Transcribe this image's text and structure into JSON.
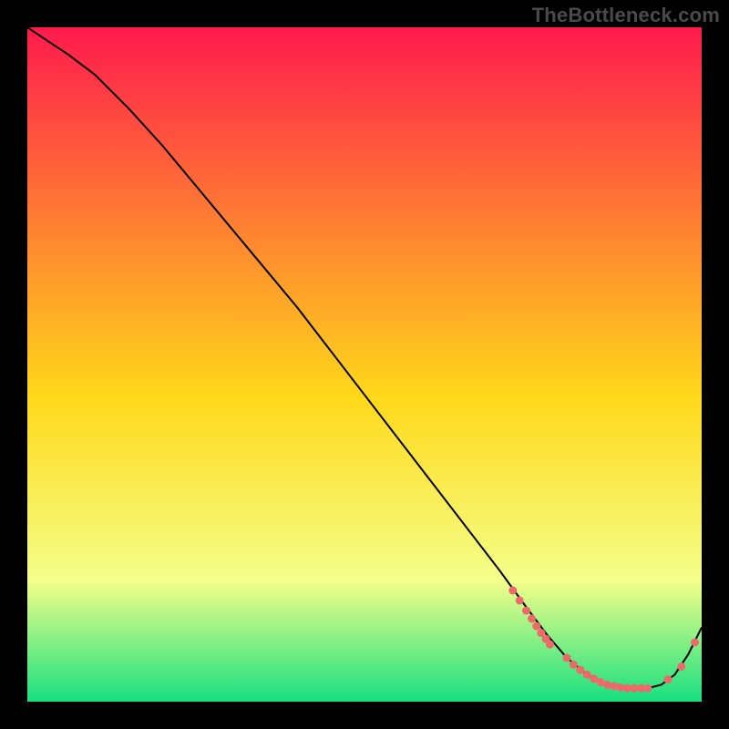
{
  "watermark": "TheBottleneck.com",
  "chart_data": {
    "type": "line",
    "title": "",
    "xlabel": "",
    "ylabel": "",
    "xlim": [
      0,
      100
    ],
    "ylim": [
      0,
      100
    ],
    "grid": false,
    "legend": false,
    "background_gradient": {
      "top": "#ff1a4d",
      "mid": "#ffd91a",
      "lower": "#f4ff8a",
      "bottom": "#17e080"
    },
    "series": [
      {
        "name": "bottleneck-curve",
        "color": "#000000",
        "x": [
          0,
          3,
          6,
          10,
          15,
          20,
          25,
          30,
          35,
          40,
          45,
          50,
          55,
          60,
          65,
          70,
          74,
          77,
          80,
          83,
          86,
          89,
          92,
          94,
          96,
          98,
          100
        ],
        "y": [
          100,
          98,
          96,
          93,
          88,
          82.5,
          76.5,
          70.5,
          64.5,
          58.5,
          52,
          45.5,
          39,
          32.5,
          26,
          19.5,
          14,
          10,
          6.5,
          4,
          2.5,
          2,
          2,
          2.5,
          4,
          7,
          11
        ]
      }
    ],
    "markers": {
      "name": "highlight-dots",
      "color": "#ed6a6a",
      "radius": 4.5,
      "clusters": [
        {
          "comment": "descending-edge cluster",
          "x": [
            72.0,
            73.0,
            74.0,
            74.8,
            75.5,
            76.2,
            76.9,
            77.5
          ],
          "y": [
            16.5,
            15.0,
            13.5,
            12.3,
            11.2,
            10.2,
            9.3,
            8.5
          ]
        },
        {
          "comment": "valley floor cluster",
          "x": [
            80.0,
            81.0,
            82.0,
            83.0,
            84.0,
            85.0,
            86.0,
            87.0,
            88.0,
            89.0,
            90.0,
            91.0,
            92.0
          ],
          "y": [
            6.5,
            5.5,
            4.7,
            4.0,
            3.4,
            2.9,
            2.5,
            2.3,
            2.1,
            2.0,
            2.0,
            2.0,
            2.0
          ]
        },
        {
          "comment": "rising-edge sparse dots",
          "x": [
            95.0,
            97.0,
            99.0
          ],
          "y": [
            3.3,
            5.2,
            8.8
          ]
        }
      ]
    }
  }
}
